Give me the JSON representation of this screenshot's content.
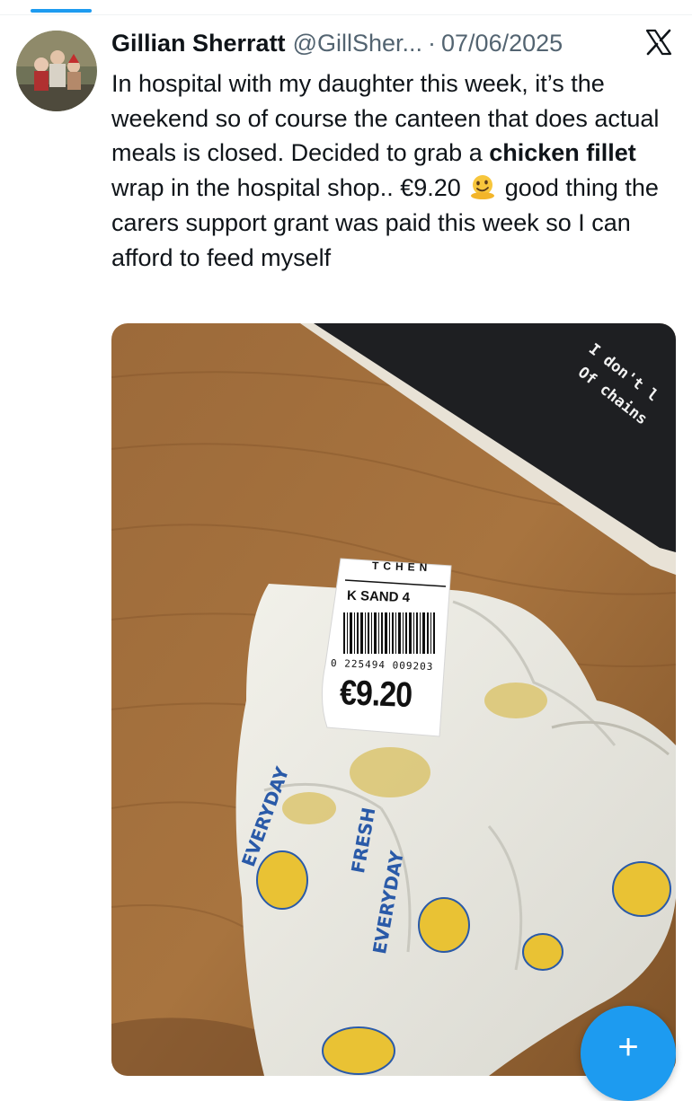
{
  "tweet": {
    "author_name": "Gillian Sherratt",
    "author_handle": "@GillSher...",
    "separator": "·",
    "date": "07/06/2025",
    "text_part1": "In hospital with my daughter this week, it’s the weekend so of course the canteen that does actual meals is closed. Decided to grab a ",
    "text_bold": "chicken fillet",
    "text_part2": " wrap in the hospital shop.. €9.20 ",
    "text_part3": " good thing the carers support grant was paid this week so I can afford to feed myself",
    "emoji_name": "melting-face-emoji"
  },
  "media": {
    "sticker_line1": "I don't l",
    "sticker_line2": "Of chains",
    "label_brand": "TCHEN",
    "label_product": "K SAND 4",
    "label_barcode_number": "0 225494 009203",
    "label_price": "€9.20",
    "wrap_print": [
      "FRESH",
      "EVERYDAY"
    ]
  },
  "compose_button_label": "+",
  "colors": {
    "accent": "#1d9bf0",
    "text_primary": "#0f1419",
    "text_secondary": "#536471"
  },
  "icons": {
    "brand": "x-logo-icon",
    "compose": "plus-icon"
  }
}
